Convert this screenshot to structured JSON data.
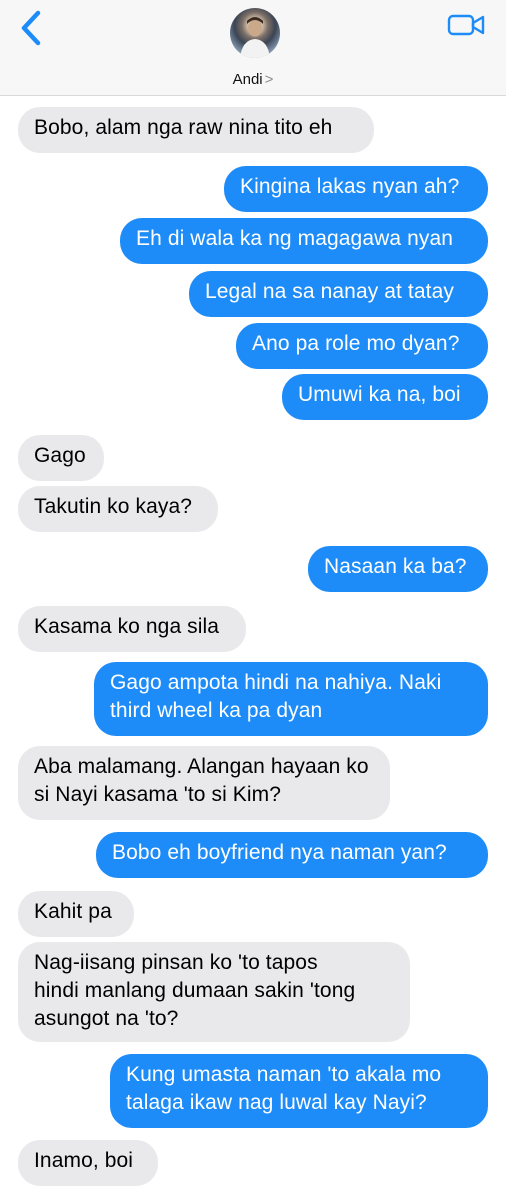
{
  "header": {
    "contact_name": "Andi",
    "chevron": ">",
    "back_icon": "chevron-left-icon",
    "video_icon": "video-camera-icon",
    "accent_color": "#1d8cf8"
  },
  "messages": [
    {
      "from": "them",
      "text": "Bobo, alam nga raw nina tito eh"
    },
    {
      "from": "me",
      "text": "Kingina lakas nyan ah?"
    },
    {
      "from": "me",
      "text": "Eh di wala ka ng magagawa nyan"
    },
    {
      "from": "me",
      "text": "Legal na sa nanay at tatay"
    },
    {
      "from": "me",
      "text": "Ano pa role mo dyan?"
    },
    {
      "from": "me",
      "text": "Umuwi ka na, boi"
    },
    {
      "from": "them",
      "text": "Gago"
    },
    {
      "from": "them",
      "text": "Takutin ko kaya?"
    },
    {
      "from": "me",
      "text": "Nasaan ka ba?"
    },
    {
      "from": "them",
      "text": "Kasama ko nga sila"
    },
    {
      "from": "me",
      "text": "Gago ampota hindi na nahiya. Naki\nthird wheel ka pa dyan"
    },
    {
      "from": "them",
      "text": "Aba malamang. Alangan hayaan ko\nsi Nayi kasama 'to si Kim?"
    },
    {
      "from": "me",
      "text": "Bobo eh boyfriend nya naman yan?"
    },
    {
      "from": "them",
      "text": "Kahit pa"
    },
    {
      "from": "them",
      "text": "Nag-iisang pinsan ko 'to tapos\nhindi manlang dumaan sakin 'tong\nasungot na 'to?"
    },
    {
      "from": "me",
      "text": "Kung umasta naman 'to akala mo\ntalaga ikaw nag luwal kay Nayi?"
    },
    {
      "from": "them",
      "text": "Inamo, boi"
    }
  ]
}
